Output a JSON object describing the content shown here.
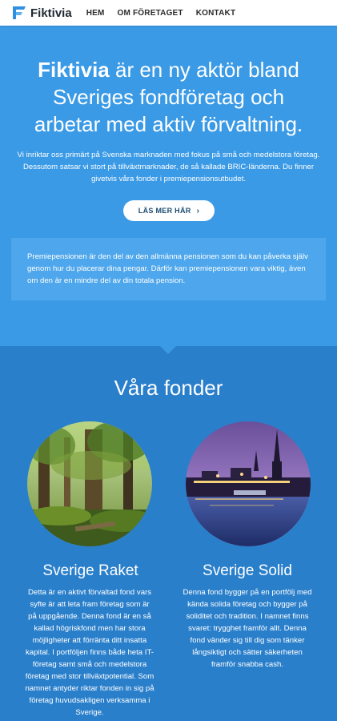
{
  "nav": {
    "logo_text": "Fiktivia",
    "links": [
      "HEM",
      "OM FÖRETAGET",
      "KONTAKT"
    ]
  },
  "hero": {
    "title_brand": "Fiktivia",
    "title_line1_rest": " är en ny aktör bland",
    "title_line2": "Sveriges fondföretag och",
    "title_line3": "arbetar med aktiv förvaltning.",
    "lead": "Vi inriktar oss primärt på Svenska marknaden med fokus på små och medelstora företag. Dessutom satsar vi stort på tillväxtmarknader, de så kallade BRIC-länderna. Du finner givetvis våra fonder i premiepensionsutbudet.",
    "button_label": "LÄS MER HÄR",
    "button_icon": "chevron-right-icon",
    "note": "Premiepensionen är den del av den allmänna pensionen som du kan påverka själv genom hur du placerar dina pengar. Därför kan premiepensionen vara viktig, även om den är en mindre del av din totala pension."
  },
  "funds": {
    "heading": "Våra fonder",
    "items": [
      {
        "title": "Sverige Raket",
        "image": "forest-photo",
        "description": "Detta är en aktivt förvaltad fond vars syfte är att leta fram företag som är på uppgående. Denna fond är en så kallad högriskfond men har stora möjligheter att förränta ditt insatta kapital. I portföljen finns både heta IT-företag samt små och medelstora företag med stor tillväxtpotential. Som namnet antyder riktar fonden in sig på företag huvudsakligen verksamma i Sverige."
      },
      {
        "title": "Sverige Solid",
        "image": "stockholm-night-photo",
        "description": "Denna fond bygger på en portfölj med kända solida företag och bygger på soliditet och tradition. I namnet finns svaret: trygghet framför allt. Denna fond vänder sig till dig som tänker långsiktigt och sätter säkerheten framför snabba cash."
      }
    ]
  },
  "colors": {
    "hero_bg": "#3a9ae6",
    "note_bg": "#4ea7ec",
    "section_bg": "#2a7fcb",
    "logo_accent": "#2f8fe0"
  }
}
